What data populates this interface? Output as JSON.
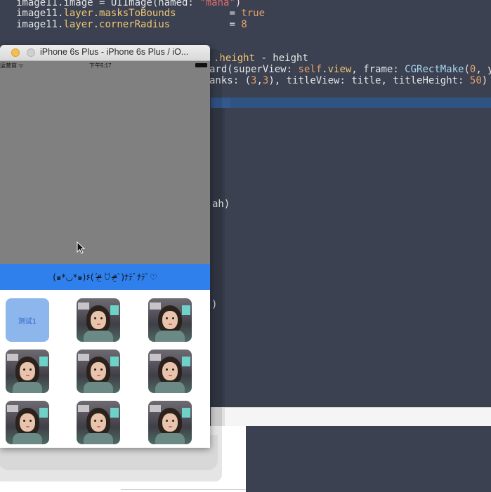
{
  "editor": {
    "lines": [
      {
        "id": "l1",
        "segments": [
          {
            "t": "image11.image = UIImage(named: ",
            "c": "plain"
          },
          {
            "t": "\"mana\"",
            "c": "str"
          },
          {
            "t": ")",
            "c": "plain"
          }
        ]
      },
      {
        "id": "l2",
        "segments": [
          {
            "t": "image11.",
            "c": "plain"
          },
          {
            "t": "layer",
            "c": "prop"
          },
          {
            "t": ".",
            "c": "plain"
          },
          {
            "t": "masksToBounds",
            "c": "prop"
          },
          {
            "t": "         = ",
            "c": "plain"
          },
          {
            "t": "true",
            "c": "num"
          }
        ]
      },
      {
        "id": "l3",
        "segments": [
          {
            "t": "image11.",
            "c": "plain"
          },
          {
            "t": "layer",
            "c": "prop"
          },
          {
            "t": ".",
            "c": "plain"
          },
          {
            "t": "cornerRadius",
            "c": "prop"
          },
          {
            "t": "          = ",
            "c": "plain"
          },
          {
            "t": "8",
            "c": "num"
          }
        ]
      },
      {
        "id": "l4",
        "segments": [
          {
            "t": ".height",
            "c": "prop"
          },
          {
            "t": " - height",
            "c": "plain"
          }
        ]
      },
      {
        "id": "l5",
        "segments": [
          {
            "t": "ard(superView: ",
            "c": "plain"
          },
          {
            "t": "self",
            "c": "num"
          },
          {
            "t": ".",
            "c": "plain"
          },
          {
            "t": "view",
            "c": "prop"
          },
          {
            "t": ", frame: ",
            "c": "plain"
          },
          {
            "t": "CGRectMake",
            "c": "fn"
          },
          {
            "t": "(",
            "c": "plain"
          },
          {
            "t": "0",
            "c": "num"
          },
          {
            "t": ", y",
            "c": "plain"
          }
        ]
      },
      {
        "id": "l6",
        "segments": [
          {
            "t": "anks: (",
            "c": "plain"
          },
          {
            "t": "3",
            "c": "num"
          },
          {
            "t": ",",
            "c": "plain"
          },
          {
            "t": "3",
            "c": "num"
          },
          {
            "t": "), titleView: title, titleHeight: ",
            "c": "plain"
          },
          {
            "t": "50",
            "c": "num"
          },
          {
            "t": ")",
            "c": "plain"
          }
        ]
      },
      {
        "id": "l7",
        "segments": [
          {
            "t": "ah)",
            "c": "plain"
          }
        ]
      },
      {
        "id": "l8",
        "segments": [
          {
            "t": ")",
            "c": "plain"
          }
        ]
      }
    ]
  },
  "simulator": {
    "window_title": "iPhone 6s Plus - iPhone 6s Plus / iO...",
    "status_carrier": "运营商 ᯤ",
    "status_time": "下午5:17",
    "title_view_text": "(๑*◡*๑)۶(ˊᵒ̴̶̷̤ ꇴ ᵒ̴̶̷̤ˋ)ﾅﾃﾞﾅﾃﾞ♡",
    "button_label": "测试1",
    "grid": [
      [
        "button",
        "photo",
        "photo"
      ],
      [
        "photo",
        "photo",
        "photo"
      ],
      [
        "photo",
        "photo",
        "photo"
      ]
    ]
  },
  "colors": {
    "editor_bg": "#3b4151",
    "title_view_bg": "#2f80ed",
    "button_tile_bg": "#8db6ec",
    "sim_content_gray": "#808080"
  }
}
